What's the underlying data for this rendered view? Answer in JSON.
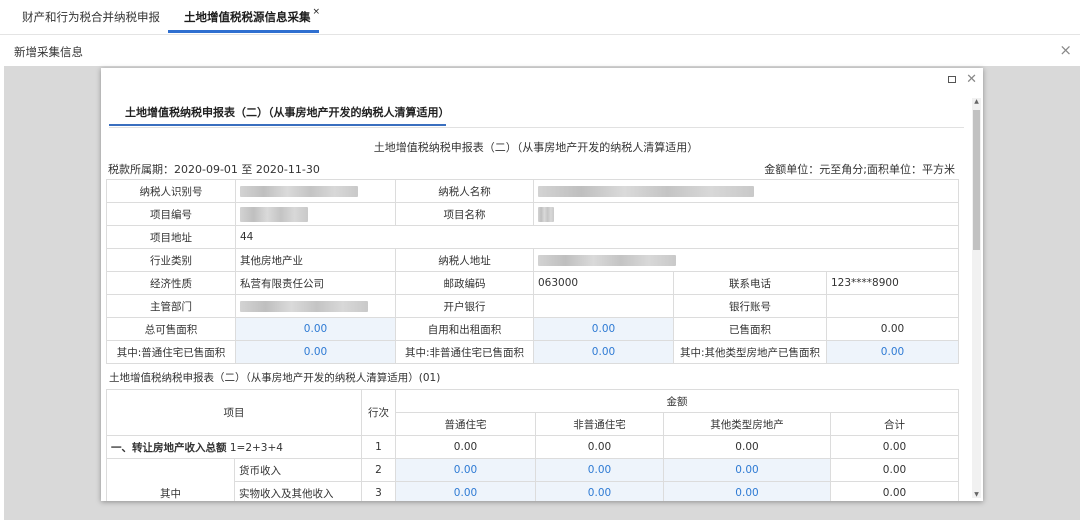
{
  "tabs": [
    {
      "label": "财产和行为税合并纳税申报"
    },
    {
      "label": "土地增值税税源信息采集",
      "close": "×"
    }
  ],
  "subheader": {
    "title": "新增采集信息",
    "close": "×"
  },
  "modal": {
    "section_tab": "土地增值税纳税申报表（二）（从事房地产开发的纳税人清算适用）",
    "report_title": "土地增值税纳税申报表（二）（从事房地产开发的纳税人清算适用）",
    "period": "税款所属期：2020-09-01 至 2020-11-30",
    "unit": "金额单位：元至角分;面积单位：平方米"
  },
  "info": {
    "taxpayer_id_label": "纳税人识别号",
    "taxpayer_name_label": "纳税人名称",
    "project_no_label": "项目编号",
    "project_name_label": "项目名称",
    "project_addr_label": "项目地址",
    "project_addr": "44",
    "industry_label": "行业类别",
    "industry": "其他房地产业",
    "taxpayer_addr_label": "纳税人地址",
    "econ_label": "经济性质",
    "econ": "私营有限责任公司",
    "postcode_label": "邮政编码",
    "postcode": "063000",
    "phone_label": "联系电话",
    "phone": "123****8900",
    "dept_label": "主管部门",
    "bank_label": "开户银行",
    "account_label": "银行账号",
    "total_sale_area_label": "总可售面积",
    "total_sale_area": "0.00",
    "self_use_area_label": "自用和出租面积",
    "self_use_area": "0.00",
    "sold_area_label": "已售面积",
    "sold_area": "0.00",
    "ordinary_sold_label": "其中:普通住宅已售面积",
    "ordinary_sold": "0.00",
    "nonordinary_sold_label": "其中:非普通住宅已售面积",
    "nonordinary_sold": "0.00",
    "other_sold_label": "其中:其他类型房地产已售面积",
    "other_sold": "0.00"
  },
  "detail": {
    "section_label": "土地增值税纳税申报表（二）（从事房地产开发的纳税人清算适用）(01)",
    "headers": {
      "item": "项目",
      "line": "行次",
      "amount": "金额",
      "ordinary": "普通住宅",
      "nonordinary": "非普通住宅",
      "other": "其他类型房地产",
      "total": "合计"
    },
    "rows": [
      {
        "item_bold": "一、转让房地产收入总额",
        "item_rest": " 1=2+3+4",
        "line": "1",
        "v1": "0.00",
        "v2": "0.00",
        "v3": "0.00",
        "v4": "0.00"
      },
      {
        "group": "其中",
        "item": "货币收入",
        "line": "2",
        "v1": "0.00",
        "v2": "0.00",
        "v3": "0.00",
        "v4": "0.00"
      },
      {
        "item": "实物收入及其他收入",
        "line": "3",
        "v1": "0.00",
        "v2": "0.00",
        "v3": "0.00",
        "v4": "0.00"
      }
    ]
  }
}
